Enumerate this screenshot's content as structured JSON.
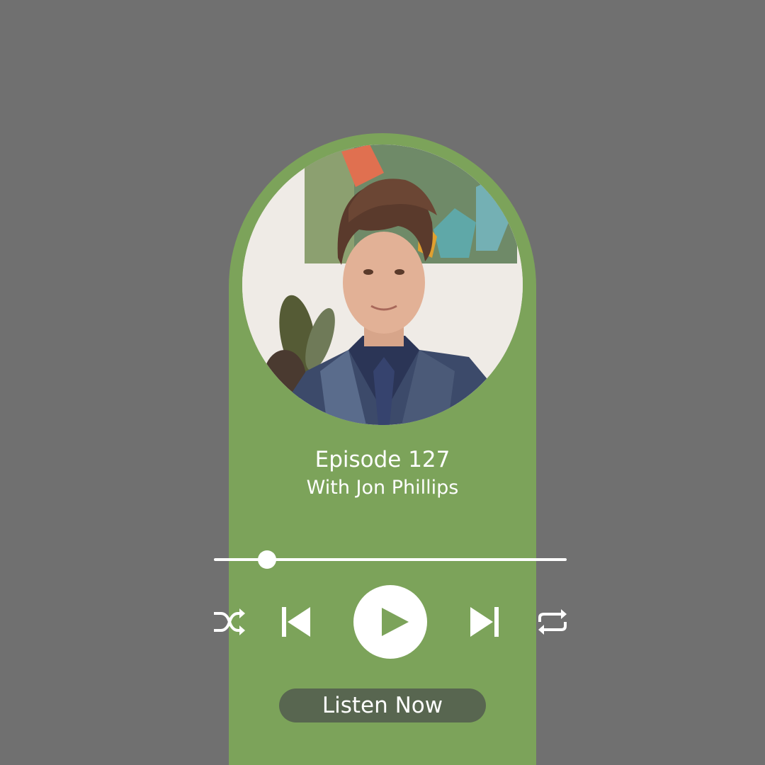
{
  "episode": {
    "title": "Episode 127",
    "guest_line": "With Jon Phillips"
  },
  "player": {
    "progress": 0.15,
    "controls": [
      "shuffle-icon",
      "previous-icon",
      "play-icon",
      "next-icon",
      "repeat-icon"
    ],
    "cta_label": "Listen Now"
  },
  "theme": {
    "background": "#707070",
    "accent_green": "#7ca35a",
    "button_dark": "#586650",
    "foreground": "#ffffff"
  }
}
